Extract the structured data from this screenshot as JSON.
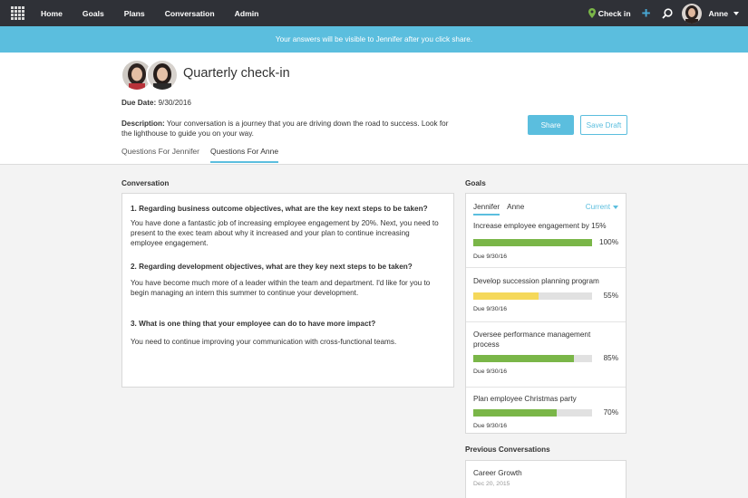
{
  "nav": {
    "items": [
      "Home",
      "Goals",
      "Plans",
      "Conversation",
      "Admin"
    ],
    "checkin_label": "Check in",
    "user_name": "Anne"
  },
  "banner": {
    "text": "Your answers will be visible to Jennifer after you click share."
  },
  "header": {
    "title": "Quarterly check-in",
    "share_label": "Share",
    "save_draft_label": "Save Draft",
    "due_label": "Due Date:",
    "due_value": "9/30/2016",
    "description_label": "Description:",
    "description_text": "Your conversation is a journey that you are driving down the road to success. Look for the lighthouse to guide you on your way.",
    "tabs": [
      "Questions For Jennifer",
      "Questions For Anne"
    ],
    "active_tab": 1
  },
  "conversation": {
    "label": "Conversation",
    "items": [
      {
        "q": "1.  Regarding business outcome objectives, what are the key next steps to be taken?",
        "a": "You have done a fantastic job of increasing employee engagement by 20%. Next, you need to present to the exec team about why it increased and your plan to continue increasing employee engagement."
      },
      {
        "q": "2.  Regarding development objectives, what are they key next steps to be taken?",
        "a": "You have become much more of a leader within the team and department. I'd like for you to begin managing an intern this summer to continue your development."
      },
      {
        "q": "3.  What is one thing that your employee can do to have more impact?",
        "a": "You need to continue improving your communication with cross-functional teams."
      }
    ]
  },
  "goals": {
    "label": "Goals",
    "tabs": [
      "Jennifer",
      "Anne"
    ],
    "filter_label": "Current",
    "items": [
      {
        "title": "Increase employee engagement by 15%",
        "progress": 100,
        "percent_label": "100%",
        "due": "Due 9/30/16",
        "color": "#7ab648"
      },
      {
        "title": "Develop succession planning program",
        "progress": 55,
        "percent_label": "55%",
        "due": "Due 9/30/16",
        "color": "#f5d85a"
      },
      {
        "title": "Oversee performance management process",
        "progress": 85,
        "percent_label": "85%",
        "due": "Due 9/30/16",
        "color": "#7ab648"
      },
      {
        "title": "Plan employee Christmas party",
        "progress": 70,
        "percent_label": "70%",
        "due": "Due 9/30/16",
        "color": "#7ab648"
      }
    ]
  },
  "previous": {
    "label": "Previous Conversations",
    "items": [
      {
        "title": "Career Growth",
        "date": "Dec 20, 2015"
      }
    ]
  },
  "colors": {
    "accent": "#5bbede",
    "nav_bg": "#2f3137",
    "checkin_pin": "#7ab648"
  }
}
